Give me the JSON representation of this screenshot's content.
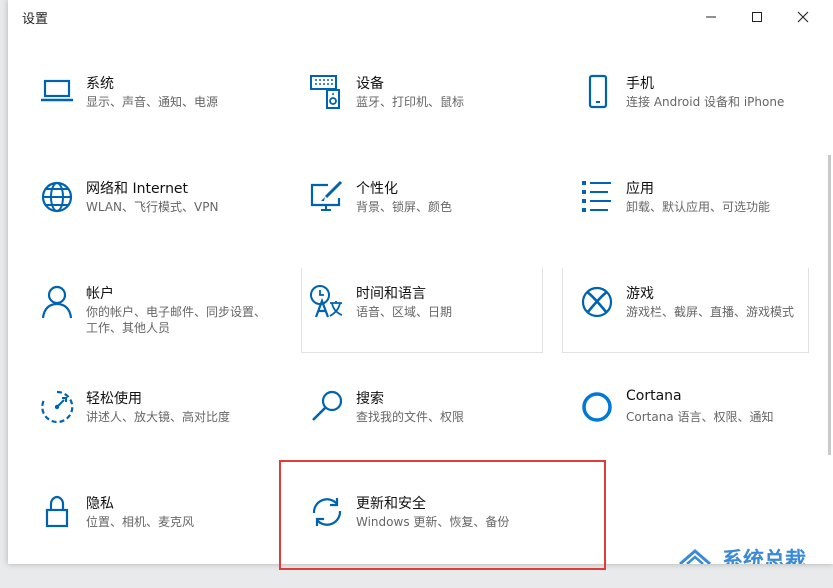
{
  "window": {
    "title": "设置"
  },
  "controls": {
    "minimize": "minimize",
    "maximize": "maximize",
    "close": "close"
  },
  "colors": {
    "accent": "#0063b1",
    "highlight": "#e03c3c",
    "watermark": "#3a8ad8"
  },
  "tiles": [
    {
      "id": "system",
      "title": "系统",
      "desc": "显示、声音、通知、电源",
      "icon": "laptop-icon"
    },
    {
      "id": "devices",
      "title": "设备",
      "desc": "蓝牙、打印机、鼠标",
      "icon": "keyboard-speaker-icon"
    },
    {
      "id": "phone",
      "title": "手机",
      "desc": "连接 Android 设备和 iPhone",
      "icon": "phone-icon"
    },
    {
      "id": "network",
      "title": "网络和 Internet",
      "desc": "WLAN、飞行模式、VPN",
      "icon": "globe-icon"
    },
    {
      "id": "personalization",
      "title": "个性化",
      "desc": "背景、锁屏、颜色",
      "icon": "paint-monitor-icon"
    },
    {
      "id": "apps",
      "title": "应用",
      "desc": "卸载、默认应用、可选功能",
      "icon": "apps-list-icon"
    },
    {
      "id": "accounts",
      "title": "帐户",
      "desc": "你的帐户、电子邮件、同步设置、工作、其他人员",
      "icon": "person-icon"
    },
    {
      "id": "time-language",
      "title": "时间和语言",
      "desc": "语音、区域、日期",
      "icon": "time-language-icon"
    },
    {
      "id": "gaming",
      "title": "游戏",
      "desc": "游戏栏、截屏、直播、游戏模式",
      "icon": "xbox-icon"
    },
    {
      "id": "ease-of-access",
      "title": "轻松使用",
      "desc": "讲述人、放大镜、高对比度",
      "icon": "ease-of-access-icon"
    },
    {
      "id": "search",
      "title": "搜索",
      "desc": "查找我的文件、权限",
      "icon": "search-icon"
    },
    {
      "id": "cortana",
      "title": "Cortana",
      "desc": "Cortana 语言、权限、通知",
      "icon": "cortana-icon"
    },
    {
      "id": "privacy",
      "title": "隐私",
      "desc": "位置、相机、麦克风",
      "icon": "lock-icon"
    },
    {
      "id": "update-security",
      "title": "更新和安全",
      "desc": "Windows 更新、恢复、备份",
      "icon": "sync-icon"
    }
  ],
  "watermark": {
    "text": "系统总裁"
  }
}
